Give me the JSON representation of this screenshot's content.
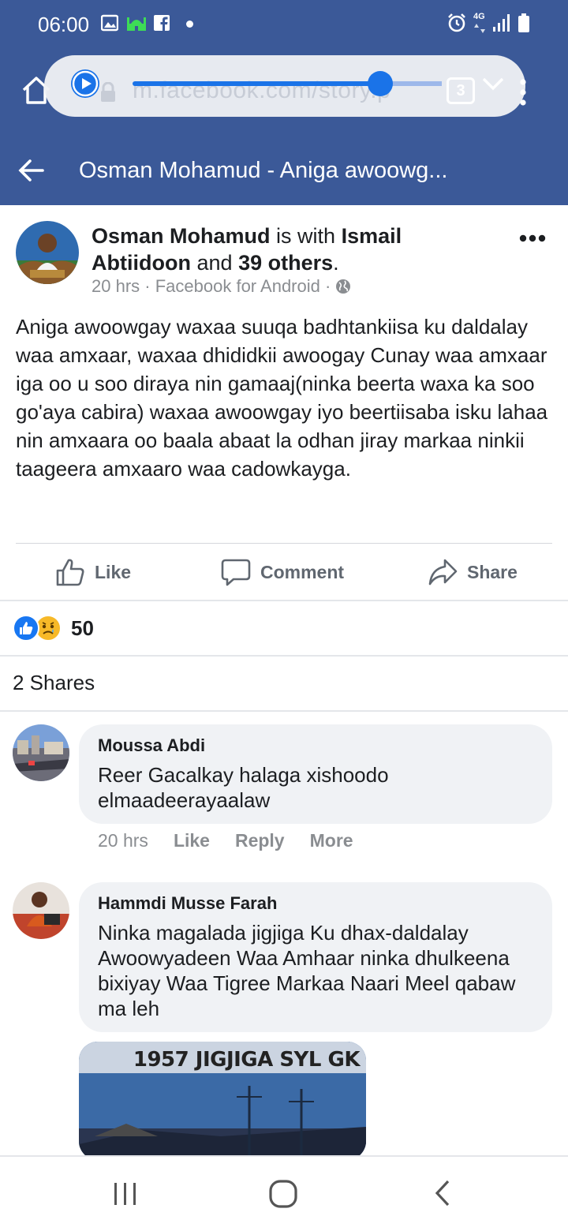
{
  "status_bar": {
    "time": "06:00",
    "network_label": "4G"
  },
  "browser": {
    "url": "m.facebook.com/story.p",
    "tab_count": "3"
  },
  "header": {
    "title": "Osman Mohamud - Aniga awoowg..."
  },
  "post": {
    "author": "Osman Mohamud",
    "with_text": "is with",
    "tagged": "Ismail Abtiidoon",
    "and_text": "and",
    "others": "39 others",
    "period": ".",
    "time": "20 hrs",
    "source": "Facebook for Android",
    "separator": "·",
    "body": "Aniga awoowgay waxaa suuqa badhtankiisa ku daldalay waa amxaar, waxaa dhididkii awoogay Cunay waa amxaar iga oo u soo diraya nin gamaaj(ninka beerta waxa ka soo go'aya cabira) waxaa awoowgay iyo beertiisaba isku lahaa nin amxaara oo baala abaat la odhan jiray markaa ninkii taageera amxaaro waa cadowkayga.",
    "actions": {
      "like": "Like",
      "comment": "Comment",
      "share": "Share"
    },
    "reaction_count": "50",
    "shares": "2 Shares"
  },
  "comments": [
    {
      "name": "Moussa Abdi",
      "text": "Reer Gacalkay halaga xishoodo elmaadeerayaalaw",
      "time": "20 hrs",
      "like": "Like",
      "reply": "Reply",
      "more": "More"
    },
    {
      "name": "Hammdi Musse Farah",
      "text": "Ninka magalada jigjiga Ku dhax-daldalay Awoowyadeen Waa Amhaar ninka dhulkeena bixiyay Waa Tigree Markaa Naari Meel qabaw ma leh",
      "attachment_caption": "1957 JIGJIGA SYL GK"
    }
  ],
  "colors": {
    "facebook_blue": "#3b5998",
    "like_blue": "#1877f2",
    "bubble_gray": "#f0f2f5"
  },
  "icons": [
    "image-icon",
    "mosque-icon",
    "facebook-icon",
    "alarm-icon",
    "signal-icon",
    "battery-icon",
    "home-icon",
    "play-icon",
    "lock-icon",
    "chevron-down-icon",
    "kebab-icon",
    "back-arrow-icon",
    "globe-icon",
    "more-dots-icon",
    "like-icon",
    "comment-icon",
    "share-icon",
    "recents-icon",
    "home-circle-icon",
    "back-icon"
  ]
}
